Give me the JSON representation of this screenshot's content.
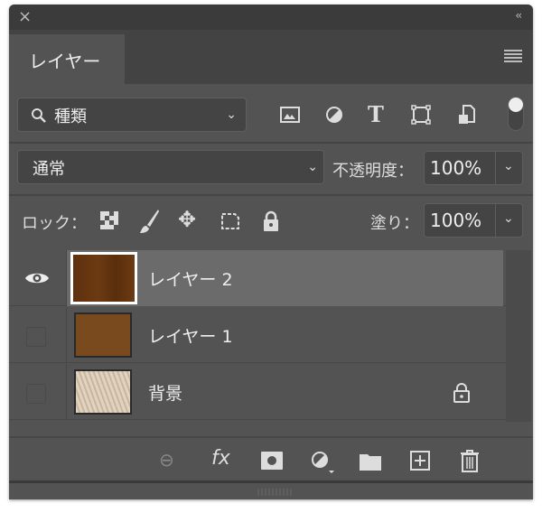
{
  "panel": {
    "close_icon": "×",
    "collapse_icon": "‹‹",
    "tab": "レイヤー"
  },
  "filter": {
    "kind": "種類",
    "search_icon": "search-icon"
  },
  "blend": {
    "mode": "通常",
    "opacity_label": "不透明度：",
    "opacity": "100%"
  },
  "lock": {
    "label": "ロック：",
    "fill_label": "塗り：",
    "fill": "100%"
  },
  "layers": [
    {
      "name": "レイヤー 2",
      "visible": true,
      "selected": true,
      "color": "#6b3a12"
    },
    {
      "name": "レイヤー 1",
      "visible": false,
      "selected": false,
      "color": "#7a4a1f"
    },
    {
      "name": "背景",
      "visible": false,
      "selected": false,
      "locked": true,
      "color": "#d8c9b5"
    }
  ],
  "footer": {
    "fx": "fx"
  }
}
